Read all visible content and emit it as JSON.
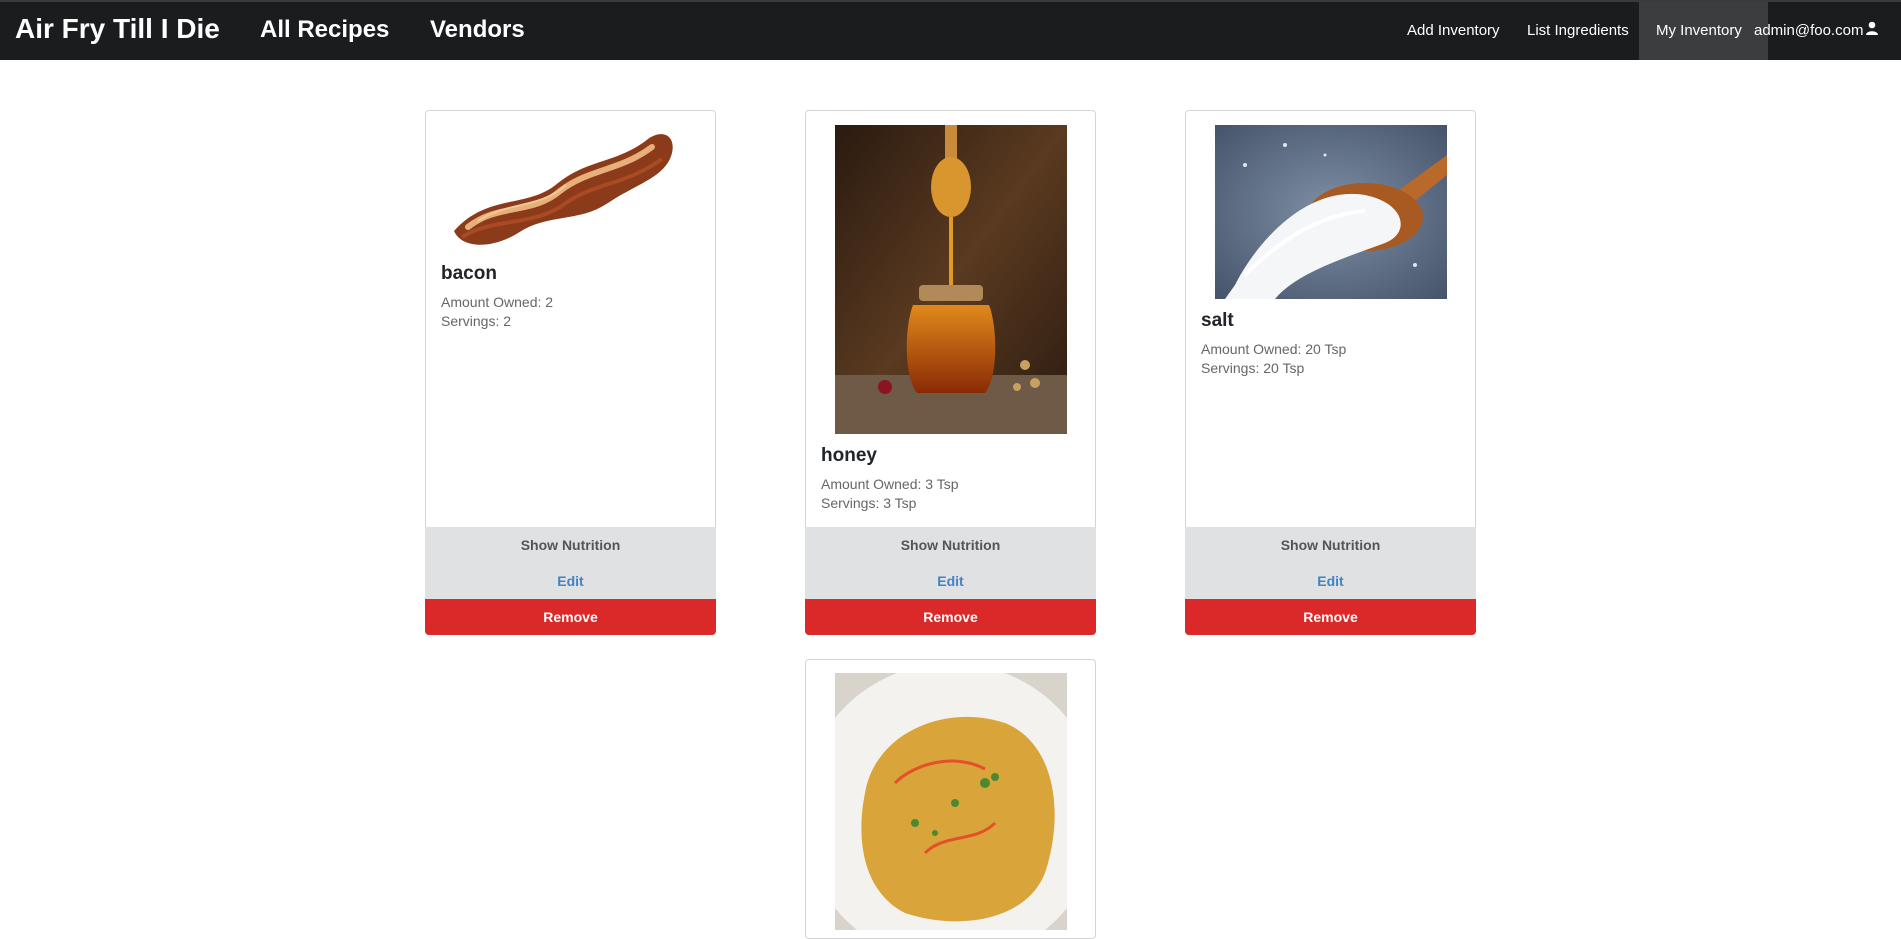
{
  "nav": {
    "brand": "Air Fry Till I Die",
    "links": [
      "All Recipes",
      "Vendors"
    ],
    "right_links": [
      "Add Inventory",
      "List Ingredients",
      "My Inventory"
    ],
    "active": "My Inventory",
    "user": "admin@foo.com"
  },
  "inventory": [
    {
      "name": "bacon",
      "amount": "Amount Owned: 2",
      "servings": "Servings: 2"
    },
    {
      "name": "honey",
      "amount": "Amount Owned: 3 Tsp",
      "servings": "Servings: 3 Tsp"
    },
    {
      "name": "salt",
      "amount": "Amount Owned: 20 Tsp",
      "servings": "Servings: 20 Tsp"
    },
    {
      "name": "",
      "amount": "",
      "servings": ""
    }
  ],
  "buttons": {
    "show": "Show Nutrition",
    "edit": "Edit",
    "remove": "Remove"
  },
  "colors": {
    "navbar": "#1b1c1d",
    "remove": "#db2828",
    "edit_link": "#4183c4",
    "button_bg": "#e0e1e2"
  },
  "icons": {
    "user": "user-icon"
  }
}
